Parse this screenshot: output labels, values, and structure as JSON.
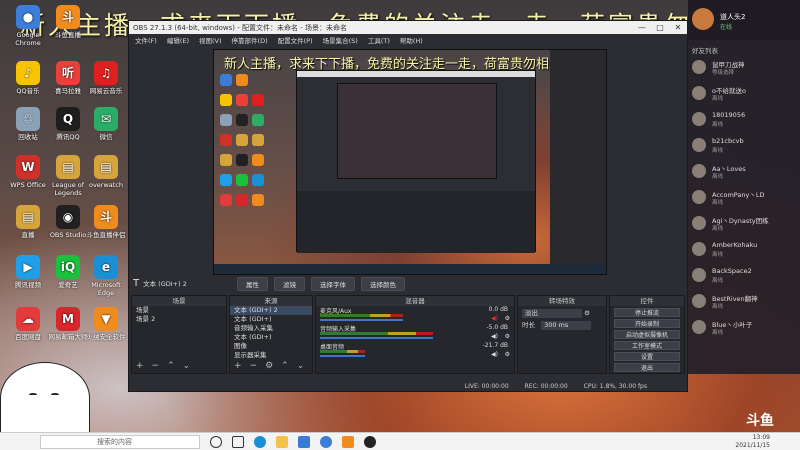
{
  "banner": "新人主播，求来下下播，免费的关注走一走，荷富贵勿相忘",
  "desktop_icons": [
    {
      "label": "Google Chrome",
      "color": "#3b7dd8",
      "glyph": "●"
    },
    {
      "label": "斗鱼直播",
      "color": "#f08c1e",
      "glyph": "斗"
    },
    {
      "label": "QQ音乐",
      "color": "#f6c400",
      "glyph": "♪"
    },
    {
      "label": "喜马拉雅",
      "color": "#e9403a",
      "glyph": "听"
    },
    {
      "label": "网易云音乐",
      "color": "#e02020",
      "glyph": "♫"
    },
    {
      "label": "回收站",
      "color": "#8aa1b8",
      "glyph": "♲"
    },
    {
      "label": "腾讯QQ",
      "color": "#1e1e1e",
      "glyph": "Q"
    },
    {
      "label": "微信",
      "color": "#2aae67",
      "glyph": "✉"
    },
    {
      "label": "WPS Office",
      "color": "#d0302a",
      "glyph": "W"
    },
    {
      "label": "League of Legends",
      "color": "#d5a43a",
      "glyph": "▤"
    },
    {
      "label": "overwatch",
      "color": "#d5a43a",
      "glyph": "▤"
    },
    {
      "label": "直播",
      "color": "#d5a43a",
      "glyph": "▤"
    },
    {
      "label": "OBS Studio",
      "color": "#202020",
      "glyph": "◉"
    },
    {
      "label": "斗鱼直播伴侣",
      "color": "#f08c1e",
      "glyph": "斗"
    },
    {
      "label": "腾讯视频",
      "color": "#1f9eea",
      "glyph": "▶"
    },
    {
      "label": "爱奇艺",
      "color": "#19c23c",
      "glyph": "iQ"
    },
    {
      "label": "Microsoft Edge",
      "color": "#1a8fd6",
      "glyph": "e"
    },
    {
      "label": "百度网盘",
      "color": "#e33b3b",
      "glyph": "☁"
    },
    {
      "label": "网易邮箱大师",
      "color": "#d8262c",
      "glyph": "M"
    },
    {
      "label": "火绒安全软件",
      "color": "#f08c1e",
      "glyph": "▼"
    }
  ],
  "obs": {
    "title": "OBS 27.1.3 (64-bit, windows) - 配置文件：未命名 - 场景：未命名",
    "menu": [
      "文件(F)",
      "编辑(E)",
      "视图(V)",
      "停靠部件(D)",
      "配置文件(P)",
      "场景集合(S)",
      "工具(T)",
      "帮助(H)"
    ],
    "source_label": "文本 (GDI+) 2",
    "toolbar_buttons": [
      "属性",
      "滤镜",
      "选择字体",
      "选择颜色"
    ],
    "docks": {
      "scenes": {
        "title": "场景",
        "items": [
          "场景",
          "场景 2"
        ]
      },
      "sources": {
        "title": "来源",
        "items": [
          "文本 (GDI+) 2",
          "文本 (GDI+)",
          "音频输入采集",
          "文本 (GDI+)",
          "图像",
          "显示器采集",
          "游戏采集"
        ]
      },
      "mixer": {
        "title": "混音器",
        "channels": [
          {
            "name": "麦克风/Aux",
            "db": "0.0 dB",
            "level": 0.55
          },
          {
            "name": "音频输入采集",
            "db": "-5.0 dB",
            "level": 0.75
          },
          {
            "name": "桌面音频",
            "db": "-21.7 dB",
            "level": 0.3
          }
        ]
      },
      "transitions": {
        "title": "转场特效",
        "type": "淡出",
        "duration_label": "时长",
        "duration": "300 ms"
      },
      "controls": {
        "title": "控件",
        "buttons": [
          "停止推流",
          "开始录制",
          "启动虚拟摄像机",
          "工作室模式",
          "设置",
          "退出"
        ]
      }
    },
    "status": {
      "live": "LIVE: 00:00:00",
      "rec": "REC: 00:00:00",
      "cpu": "CPU: 1.8%, 30.00 fps"
    }
  },
  "chat": {
    "header": "好友列表",
    "self_name": "道人头2",
    "self_status": "在线",
    "friends": [
      {
        "name": "鼠甲刀战神",
        "status": "等级选择"
      },
      {
        "name": "o不给就送o",
        "status": "离线"
      },
      {
        "name": "18019056",
        "status": "离线"
      },
      {
        "name": "b21cbcvb",
        "status": "离线"
      },
      {
        "name": "Aa丶Loves",
        "status": "离线"
      },
      {
        "name": "AccomPany丶LD",
        "status": "离线"
      },
      {
        "name": "Agi丶Dynasty团练",
        "status": "离线"
      },
      {
        "name": "AmberKohaku",
        "status": "离线"
      },
      {
        "name": "BackSpace2",
        "status": "离线"
      },
      {
        "name": "BestRiven翻神",
        "status": "离线"
      },
      {
        "name": "Blue丶小叶子",
        "status": "离线"
      }
    ]
  },
  "taskbar": {
    "search_placeholder": "搜索的内容",
    "time": "13:09",
    "date": "2021/11/15"
  },
  "watermark": "斗鱼"
}
